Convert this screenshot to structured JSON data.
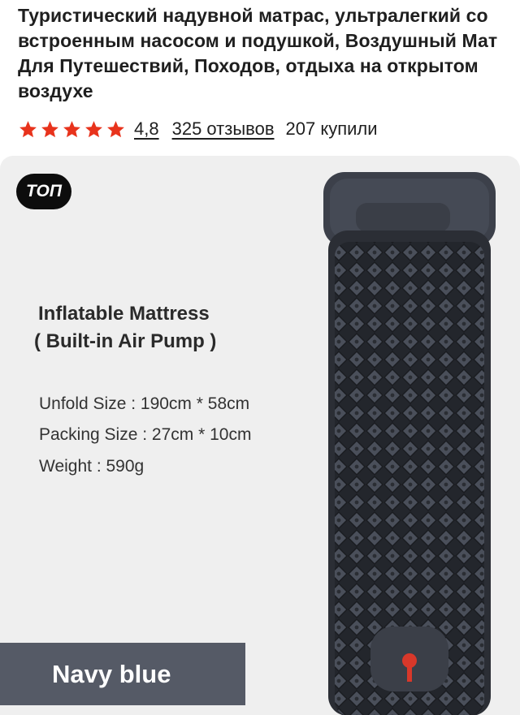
{
  "product": {
    "title": "Туристический надувной матрас, ультралегкий со встроенным насосом и подушкой, Воздушный Мат Для Путешествий, Походов, отдыха на открытом воздухе",
    "rating": "4,8",
    "rating_stars": 5,
    "reviews": "325 отзывов",
    "bought": "207 купили"
  },
  "image": {
    "badge": "ТОП",
    "heading": "Inflatable Mattress",
    "subheading": "( Built-in Air Pump )",
    "specs": [
      "Unfold Size : 190cm * 58cm",
      "Packing Size : 27cm * 10cm",
      "Weight : 590g"
    ],
    "color_label": "Navy blue"
  },
  "colors": {
    "star": "#e8331c",
    "badge_bg": "#0d0d0d",
    "color_bar_bg": "#555a66",
    "mattress": "#3b3f48"
  },
  "icons": {
    "rating": "star-icon"
  }
}
